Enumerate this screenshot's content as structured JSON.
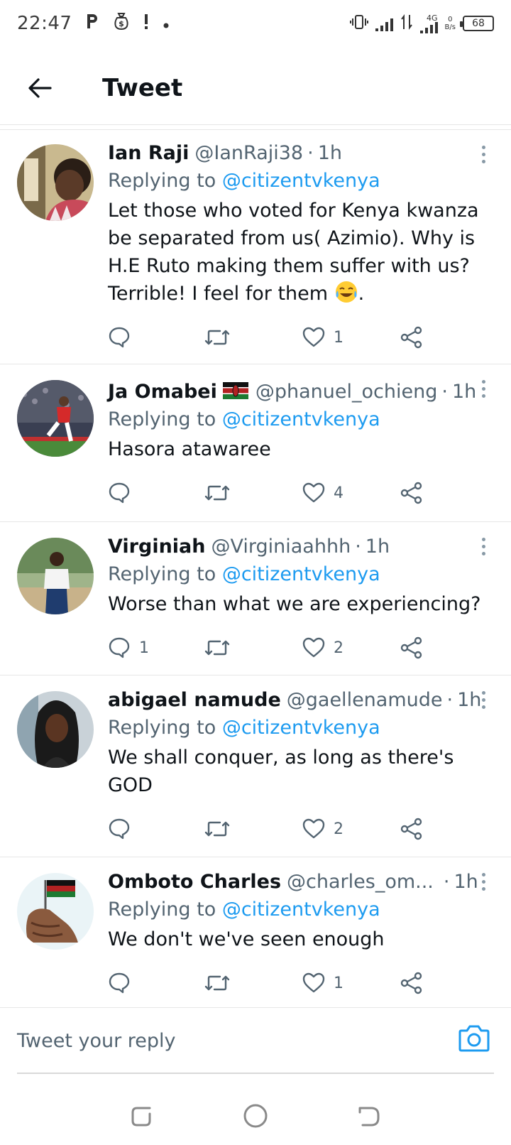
{
  "status_bar": {
    "time": "22:47",
    "network_type": "4G",
    "net_speed_value": "0",
    "net_speed_unit": "B/s",
    "battery_level": "68",
    "notification_icons": [
      "pinterest-icon",
      "money-bag-icon",
      "alert-icon",
      "dot-icon"
    ]
  },
  "header": {
    "title": "Tweet"
  },
  "tweets": [
    {
      "name": "Ian Raji",
      "handle": "@IanRaji38",
      "age": "1h",
      "replying_label": "Replying to",
      "mention": "@citizentvkenya",
      "text": "Let those who voted for Kenya kwanza be separated from us( Azimio). Why is H.E Ruto making them suffer with us? Terrible! I feel for them",
      "text_suffix": ".",
      "emoji": "tears-of-joy-emoji",
      "replies": "",
      "retweets": "",
      "likes": "1"
    },
    {
      "name": "Ja Omabei",
      "handle": "@phanuel_ochieng",
      "age": "1h",
      "replying_label": "Replying to",
      "mention": "@citizentvkenya",
      "text": "Hasora atawaree",
      "emoji": "kenya-flag-emoji",
      "replies": "",
      "retweets": "",
      "likes": "4"
    },
    {
      "name": "Virginiah",
      "handle": "@Virginiaahhh",
      "age": "1h",
      "replying_label": "Replying to",
      "mention": "@citizentvkenya",
      "text": "Worse than what we are experiencing?",
      "replies": "1",
      "retweets": "",
      "likes": "2"
    },
    {
      "name": "abigael namude",
      "handle": "@gaellenamude",
      "age": "1h",
      "replying_label": "Replying to",
      "mention": "@citizentvkenya",
      "text": "We shall conquer, as long as there's GOD",
      "replies": "",
      "retweets": "",
      "likes": "2"
    },
    {
      "name": "Omboto Charles",
      "handle": "@charles_om...",
      "age": "1h",
      "replying_label": "Replying to",
      "mention": "@citizentvkenya",
      "text": "We don't we've seen enough",
      "replies": "",
      "retweets": "",
      "likes": "1"
    }
  ],
  "reply_bar": {
    "placeholder": "Tweet your reply"
  },
  "colors": {
    "accent": "#1d9bf0",
    "secondary_text": "#536471",
    "primary_text": "#0f1419",
    "divider": "#e6e6e6"
  }
}
